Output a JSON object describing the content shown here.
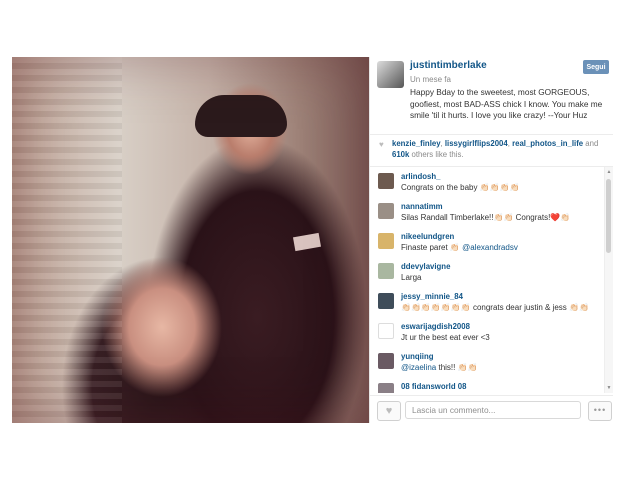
{
  "post": {
    "username": "justintimberlake",
    "timestamp": "Un mese fa",
    "follow_label": "Segui",
    "caption": "Happy Bday to the sweetest, most GORGEOUS, goofiest, most BAD-ASS chick I know. You make me smile 'til it hurts. I love you like crazy! --Your Huz"
  },
  "likes": {
    "users": [
      "kenzie_finley",
      "lissygirlflips2004",
      "real_photos_in_life"
    ],
    "sep1": ", ",
    "sep2": ", ",
    "and": " and",
    "count": "610k",
    "suffix": " others like this."
  },
  "comments": [
    {
      "user": "arlindosh_",
      "text": "Congrats on the baby 👏🏻👏🏻👏🏻👏🏻",
      "avatar_color": "#6d5a4f"
    },
    {
      "user": "nannatimm",
      "text": "Silas Randall Timberlake!!👏🏻👏🏻 Congrats!❤️👏🏻",
      "avatar_color": "#9a8f86"
    },
    {
      "user": "nikeelundgren",
      "text_prefix": "Finaste paret 👏🏻 ",
      "mention": "@alexandradsv",
      "avatar_color": "#d8b46a"
    },
    {
      "user": "ddevylavigne",
      "text": "Larga",
      "avatar_color": "#a9b7a0"
    },
    {
      "user": "jessy_minnie_84",
      "text": "👏🏻👏🏻👏🏻👏🏻👏🏻👏🏻👏🏻 congrats dear justin & jess 👏🏻👏🏻",
      "avatar_color": "#3f4d5a"
    },
    {
      "user": "eswarijagdish2008",
      "text": "Jt ur the best eat ever <3",
      "avatar_color": "#ffffff"
    },
    {
      "user": "yunqiing",
      "mention": "@izaelina",
      "text_suffix": " this!! 👏🏻👏🏻",
      "avatar_color": "#6a5a63"
    },
    {
      "user": "08 fidansworld 08",
      "text": "",
      "avatar_color": "#8a7f86"
    }
  ],
  "footer": {
    "comment_placeholder": "Lascia un commento...",
    "more_label": "•••"
  }
}
